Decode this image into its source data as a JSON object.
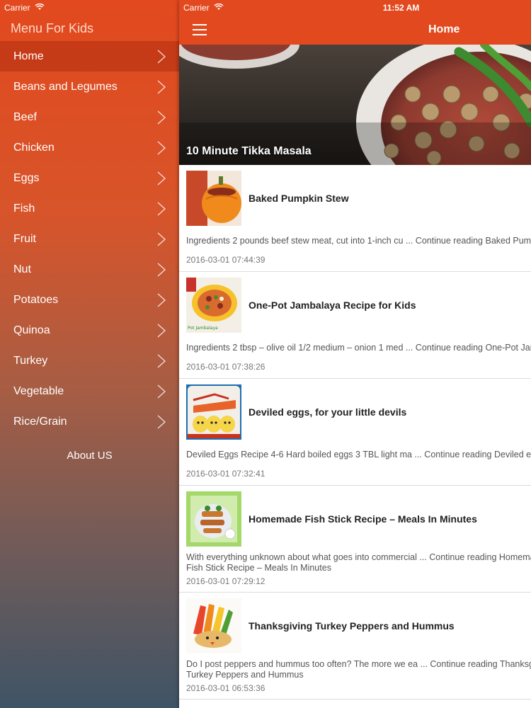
{
  "status": {
    "carrier": "Carrier",
    "time": "11:52 AM"
  },
  "sidebar": {
    "title": "Menu For Kids",
    "items": [
      {
        "label": "Home"
      },
      {
        "label": "Beans and Legumes"
      },
      {
        "label": "Beef"
      },
      {
        "label": "Chicken"
      },
      {
        "label": "Eggs"
      },
      {
        "label": "Fish"
      },
      {
        "label": "Fruit"
      },
      {
        "label": "Nut"
      },
      {
        "label": "Potatoes"
      },
      {
        "label": "Quinoa"
      },
      {
        "label": "Turkey"
      },
      {
        "label": "Vegetable"
      },
      {
        "label": "Rice/Grain"
      }
    ],
    "about": "About US"
  },
  "nav": {
    "title": "Home",
    "menu_icon": "hamburger-icon"
  },
  "hero": {
    "title": "10 Minute Tikka Masala"
  },
  "articles": [
    {
      "title": "Baked Pumpkin Stew",
      "excerpt": "Ingredients 2 pounds beef stew meat, cut into 1-inch cu ... Continue reading Baked Pumpkin Stew",
      "date": "2016-03-01 07:44:39"
    },
    {
      "title": "One-Pot Jambalaya Recipe for Kids",
      "excerpt": "Ingredients 2 tbsp – olive oil 1/2 medium – onion 1 med ... Continue reading One-Pot Jambalaya Recipe for Kids",
      "date": "2016-03-01 07:38:26"
    },
    {
      "title": "Deviled eggs, for your little devils",
      "excerpt": "Deviled Eggs Recipe 4-6 Hard boiled eggs 3 TBL light ma ... Continue reading Deviled eggs, for your little devils",
      "date": "2016-03-01 07:32:41"
    },
    {
      "title": "Homemade Fish Stick Recipe – Meals In Minutes",
      "excerpt": "With everything unknown about what goes into commercial ... Continue reading Homemade Fish Stick Recipe – Meals In Minutes",
      "date": "2016-03-01 07:29:12"
    },
    {
      "title": "Thanksgiving Turkey Peppers and Hummus",
      "excerpt": "Do I post peppers and hummus too often?  The more we ea ... Continue reading Thanksgiving Turkey Peppers and Hummus",
      "date": "2016-03-01 06:53:36"
    }
  ]
}
